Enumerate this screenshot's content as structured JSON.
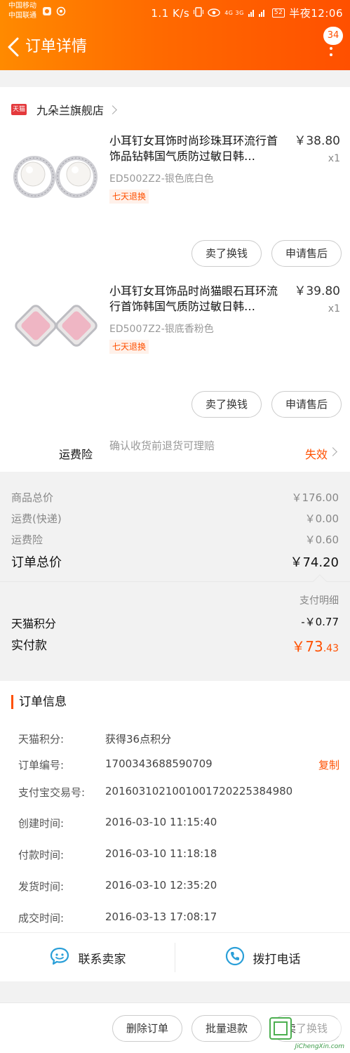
{
  "status_bar": {
    "carrier_1": "中国移动",
    "carrier_2": "中国联通",
    "net_speed": "1.1 K/s",
    "signal": "4G 3G",
    "battery": "52",
    "time": "半夜12:06"
  },
  "header": {
    "title": "订单详情",
    "message_badge": "34",
    "bg_colors": [
      "#ff8a00",
      "#ff5000"
    ]
  },
  "shop": {
    "logo_text": "天猫",
    "name": "九朵兰旗舰店"
  },
  "items": [
    {
      "title": "小耳钉女耳饰时尚珍珠耳环流行首饰品钻韩国气质防过敏日韩…",
      "price": "￥38.80",
      "qty": "x1",
      "sku": "ED5002Z2-银色底白色",
      "tag": "七天退换",
      "btn_sell": "卖了换钱",
      "btn_after_sale": "申请售后"
    },
    {
      "title": "小耳钉女耳饰品时尚猫眼石耳环流行首饰韩国气质防过敏日韩…",
      "price": "￥39.80",
      "qty": "x1",
      "sku": "ED5007Z2-银底香粉色",
      "tag": "七天退换",
      "btn_sell": "卖了换钱",
      "btn_after_sale": "申请售后"
    }
  ],
  "insurance": {
    "label": "运费险",
    "desc": "确认收货前退货可理赔",
    "status": "失效"
  },
  "totals": {
    "goods_label": "商品总价",
    "goods_value": "￥176.00",
    "shipping_label": "运费(快递)",
    "shipping_value": "￥0.00",
    "insurance_label": "运费险",
    "insurance_value": "￥0.60",
    "order_total_label": "订单总价",
    "order_total_value": "￥74.20"
  },
  "payment": {
    "detail_link": "支付明细",
    "points_label": "天猫积分",
    "points_value": "-￥0.77",
    "paid_label": "实付款",
    "paid_int": "￥73",
    "paid_dec": ".43"
  },
  "order_info": {
    "title": "订单信息",
    "rows": [
      {
        "key": "天猫积分:",
        "value": "获得36点积分"
      },
      {
        "key": "订单编号:",
        "value": "1700343688590709"
      },
      {
        "key": "支付宝交易号:",
        "value": "2016031021001001720225384980"
      },
      {
        "key": "创建时间:",
        "value": "2016-03-10 11:15:40"
      },
      {
        "key": "付款时间:",
        "value": "2016-03-10 11:18:18"
      },
      {
        "key": "发货时间:",
        "value": "2016-03-10 12:35:20"
      },
      {
        "key": "成交时间:",
        "value": "2016-03-13 17:08:17"
      }
    ],
    "copy_label": "复制"
  },
  "contact": {
    "seller_label": "联系卖家",
    "phone_label": "拨打电话"
  },
  "bottom_bar": {
    "delete_label": "删除订单",
    "batch_refund_label": "批量退款",
    "sell_label": "卖了换钱"
  },
  "watermark": {
    "text": "JiChengXin.com"
  },
  "colors": {
    "accent": "#ff5000",
    "price_text": "#333333",
    "muted": "#999999"
  }
}
